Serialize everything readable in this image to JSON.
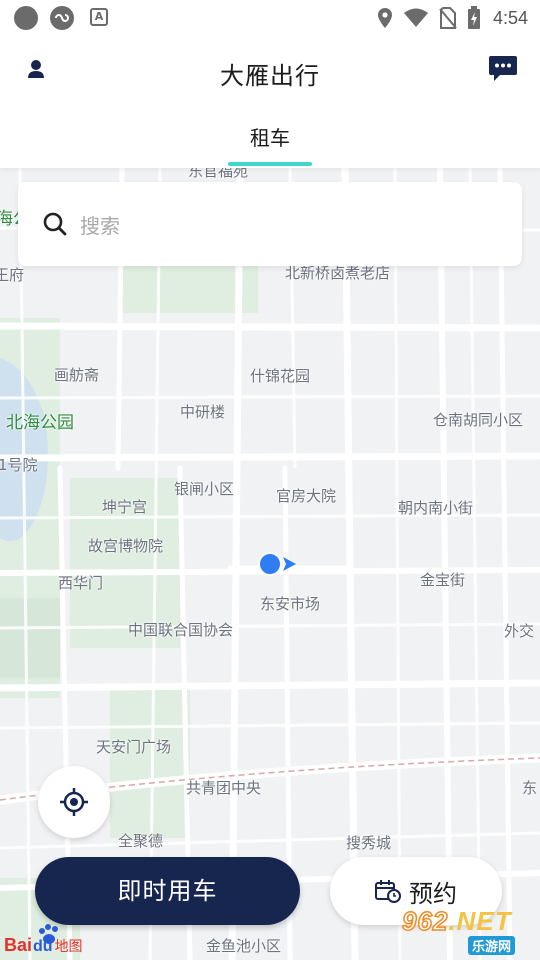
{
  "status_bar": {
    "time": "4:54",
    "app_icon_letter": "A"
  },
  "header": {
    "title": "大雁出行",
    "tab": "租车"
  },
  "search": {
    "placeholder": "搜索"
  },
  "map": {
    "labels": [
      {
        "text": "东官福苑",
        "style": "normal"
      },
      {
        "text": "海公",
        "style": "green"
      },
      {
        "text": "王府",
        "style": "normal"
      },
      {
        "text": "北新桥卤煮老店",
        "style": "normal"
      },
      {
        "text": "画舫斋",
        "style": "normal"
      },
      {
        "text": "什锦花园",
        "style": "normal"
      },
      {
        "text": "中研楼",
        "style": "normal"
      },
      {
        "text": "北海公园",
        "style": "green"
      },
      {
        "text": "仓南胡同小区",
        "style": "normal"
      },
      {
        "text": "1号院",
        "style": "normal"
      },
      {
        "text": "银闸小区",
        "style": "normal"
      },
      {
        "text": "官房大院",
        "style": "normal"
      },
      {
        "text": "坤宁宫",
        "style": "normal"
      },
      {
        "text": "朝内南小街",
        "style": "normal"
      },
      {
        "text": "故宫博物院",
        "style": "normal"
      },
      {
        "text": "西华门",
        "style": "normal"
      },
      {
        "text": "金宝街",
        "style": "normal"
      },
      {
        "text": "东安市场",
        "style": "normal"
      },
      {
        "text": "中国联合国协会",
        "style": "normal"
      },
      {
        "text": "外交",
        "style": "normal"
      },
      {
        "text": "天安门广场",
        "style": "normal"
      },
      {
        "text": "共青团中央",
        "style": "normal"
      },
      {
        "text": "东",
        "style": "normal"
      },
      {
        "text": "全聚德",
        "style": "normal"
      },
      {
        "text": "搜秀城",
        "style": "normal"
      },
      {
        "text": "金鱼池小区",
        "style": "normal"
      }
    ],
    "colors": {
      "park": "#dceedd",
      "road": "#ffffff",
      "water": "#c9dcf0",
      "location_dot": "#2f7df2"
    }
  },
  "buttons": {
    "instant": "即时用车",
    "reserve": "预约"
  },
  "baidu_logo": {
    "part1": "Bai",
    "part2": "du",
    "part3": "地图"
  },
  "watermark": {
    "number": "962",
    "dot_net": ".NET",
    "sub": "乐游网"
  },
  "colors": {
    "primary": "#17264e",
    "tab_accent": "#3fd6cb"
  }
}
